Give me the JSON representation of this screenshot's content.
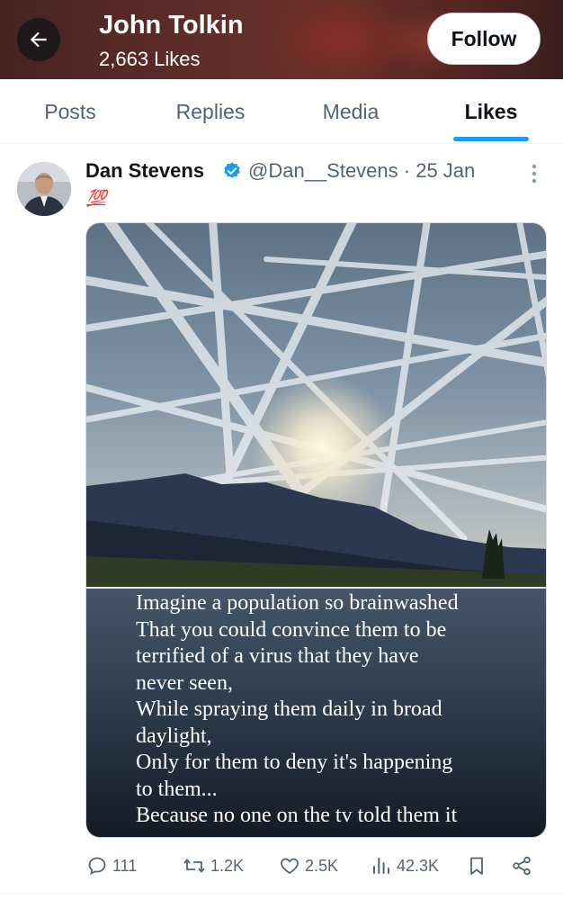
{
  "header": {
    "name": "John Tolkin",
    "likes_count": "2,663 Likes",
    "follow_label": "Follow"
  },
  "tabs": [
    {
      "label": "Posts",
      "active": false
    },
    {
      "label": "Replies",
      "active": false
    },
    {
      "label": "Media",
      "active": false
    },
    {
      "label": "Likes",
      "active": true
    }
  ],
  "post": {
    "author_name": "Dan Stevens",
    "handle_time": "@Dan__Stevens · 25 Jan",
    "text": "💯",
    "media_caption": "Imagine a population so brainwashed\nThat you could convince them to be\nterrified of a virus that they have\nnever seen,\nWhile spraying them daily in broad\ndaylight,\nOnly for them to deny it's happening\nto them...\nBecause no one on the tv told them it",
    "actions": {
      "replies": "111",
      "reposts": "1.2K",
      "likes": "2.5K",
      "views": "42.3K"
    }
  },
  "colors": {
    "accent": "#1d9bf0",
    "text_primary": "#0f1419",
    "text_secondary": "#536471",
    "emoji_red": "#e8245c"
  },
  "icons": [
    "back-arrow-icon",
    "verified-badge-icon",
    "more-icon",
    "reply-icon",
    "repost-icon",
    "like-icon",
    "views-icon",
    "bookmark-icon",
    "share-icon"
  ]
}
